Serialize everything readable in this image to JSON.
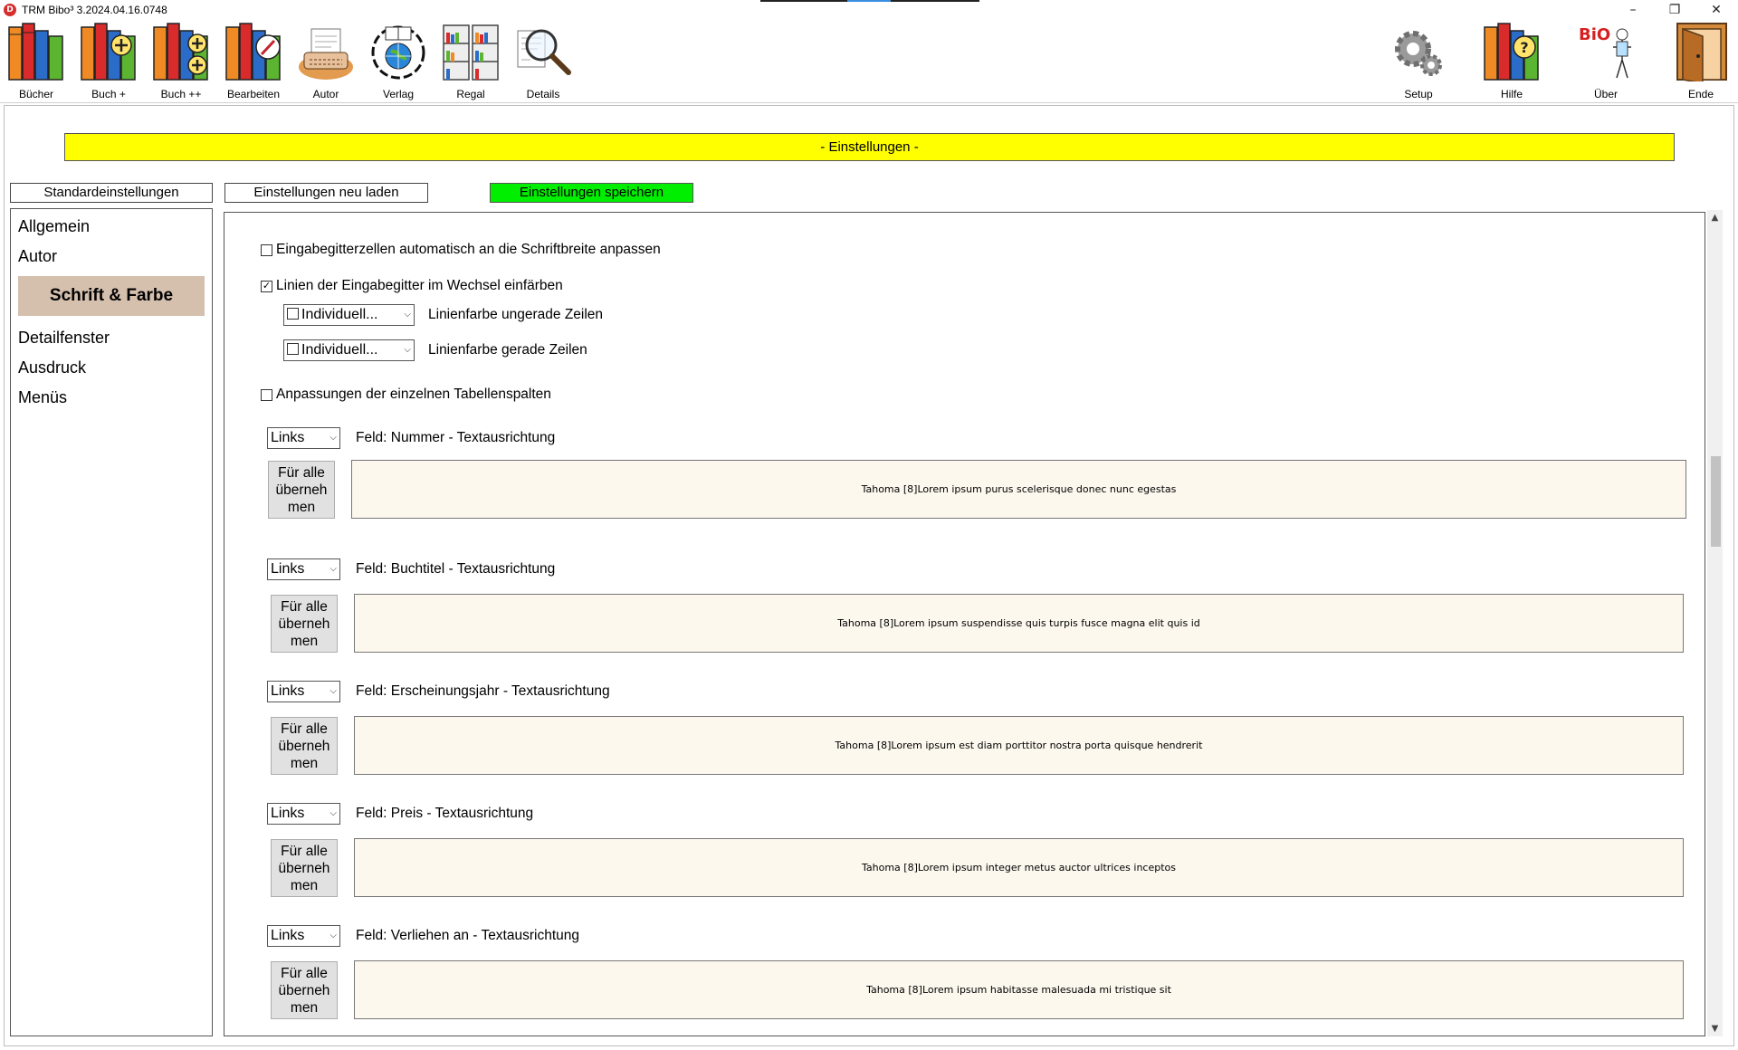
{
  "window": {
    "title": "TRM Bibo³ 3.2024.04.16.0748",
    "minimize": "–",
    "restore": "❐",
    "close": "✕"
  },
  "toolbar": {
    "left": [
      {
        "label": "Bücher",
        "icon": "books-icon"
      },
      {
        "label": "Buch +",
        "icon": "book-add-icon"
      },
      {
        "label": "Buch ++",
        "icon": "book-add-multiple-icon"
      },
      {
        "label": "Bearbeiten",
        "icon": "book-edit-icon"
      },
      {
        "label": "Autor",
        "icon": "typewriter-icon"
      },
      {
        "label": "Verlag",
        "icon": "publisher-globe-icon"
      },
      {
        "label": "Regal",
        "icon": "bookshelf-icon"
      },
      {
        "label": "Details",
        "icon": "magnifier-icon"
      }
    ],
    "right": [
      {
        "label": "Setup",
        "icon": "gears-icon"
      },
      {
        "label": "Hilfe",
        "icon": "help-books-icon"
      },
      {
        "label": "Über",
        "icon": "about-bio-icon"
      },
      {
        "label": "Ende",
        "icon": "exit-door-icon"
      }
    ]
  },
  "banner": "- Einstellungen -",
  "actions": {
    "defaults": "Standardeinstellungen",
    "reload": "Einstellungen neu laden",
    "save": "Einstellungen speichern"
  },
  "nav": {
    "items": [
      "Allgemein",
      "Autor",
      "Schrift & Farbe",
      "Detailfenster",
      "Ausdruck",
      "Menüs"
    ],
    "active_index": 2
  },
  "settings": {
    "auto_fit": {
      "label": "Eingabegitterzellen automatisch an die Schriftbreite anpassen",
      "checked": false
    },
    "alternate_lines": {
      "label": "Linien der Eingabegitter im Wechsel einfärben",
      "checked": true
    },
    "odd_color": {
      "value": "Individuell...",
      "label": "Linienfarbe ungerade Zeilen"
    },
    "even_color": {
      "value": "Individuell...",
      "label": "Linienfarbe gerade Zeilen"
    },
    "column_adjust": {
      "label": "Anpassungen der einzelnen Tabellenspalten",
      "checked": false
    }
  },
  "fields": [
    {
      "align": "Links",
      "label": "Feld: Nummer - Textausrichtung",
      "apply": "Für alle überneh men",
      "preview": "Tahoma [8]Lorem ipsum purus scelerisque donec nunc egestas"
    },
    {
      "align": "Links",
      "label": "Feld: Buchtitel - Textausrichtung",
      "apply": "Für alle überneh men",
      "preview": "Tahoma [8]Lorem ipsum suspendisse quis turpis fusce magna elit quis id"
    },
    {
      "align": "Links",
      "label": "Feld: Erscheinungsjahr - Textausrichtung",
      "apply": "Für alle überneh men",
      "preview": "Tahoma [8]Lorem ipsum est diam porttitor nostra porta quisque hendrerit"
    },
    {
      "align": "Links",
      "label": "Feld: Preis - Textausrichtung",
      "apply": "Für alle überneh men",
      "preview": "Tahoma [8]Lorem ipsum integer metus auctor ultrices inceptos"
    },
    {
      "align": "Links",
      "label": "Feld: Verliehen an - Textausrichtung",
      "apply": "Für alle überneh men",
      "preview": "Tahoma [8]Lorem ipsum habitasse malesuada mi tristique sit"
    }
  ],
  "colors": {
    "banner": "#ffff00",
    "save_button": "#00ee00",
    "nav_active": "#d5c0ae",
    "preview_bg": "#fdf8ee"
  }
}
